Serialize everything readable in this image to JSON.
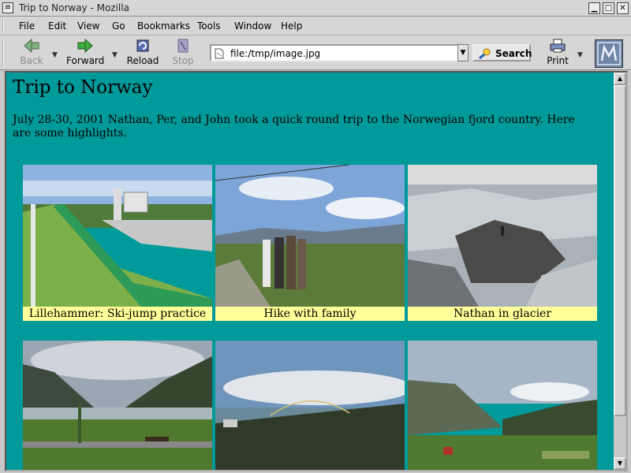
{
  "window": {
    "title": "Trip to Norway - Mozilla"
  },
  "menu": [
    {
      "label": "File"
    },
    {
      "label": "Edit"
    },
    {
      "label": "View"
    },
    {
      "label": "Go"
    },
    {
      "label": "Bookmarks"
    },
    {
      "label": "Tools"
    },
    {
      "label": "Window"
    },
    {
      "label": "Help"
    }
  ],
  "toolbar": {
    "back_label": "Back",
    "forward_label": "Forward",
    "reload_label": "Reload",
    "stop_label": "Stop",
    "print_label": "Print",
    "search_label": "Search",
    "url_value": "file:/tmp/image.jpg"
  },
  "page": {
    "heading": "Trip to Norway",
    "intro": "July 28-30, 2001 Nathan, Per, and John took a quick round trip to the Norwegian fjord country. Here are some highlights.",
    "background": "#009a9a",
    "caption_background": "#ffff99",
    "photos": [
      {
        "caption": "Lillehammer: Ski-jump practice"
      },
      {
        "caption": "Hike with family"
      },
      {
        "caption": "Nathan in glacier"
      },
      {
        "caption": ""
      },
      {
        "caption": ""
      },
      {
        "caption": ""
      }
    ]
  },
  "icons": {
    "back": "back-arrow-icon",
    "forward": "forward-arrow-icon",
    "reload": "reload-icon",
    "stop": "stop-icon",
    "print": "printer-icon",
    "search": "search-icon",
    "throbber": "mozilla-logo-icon"
  }
}
